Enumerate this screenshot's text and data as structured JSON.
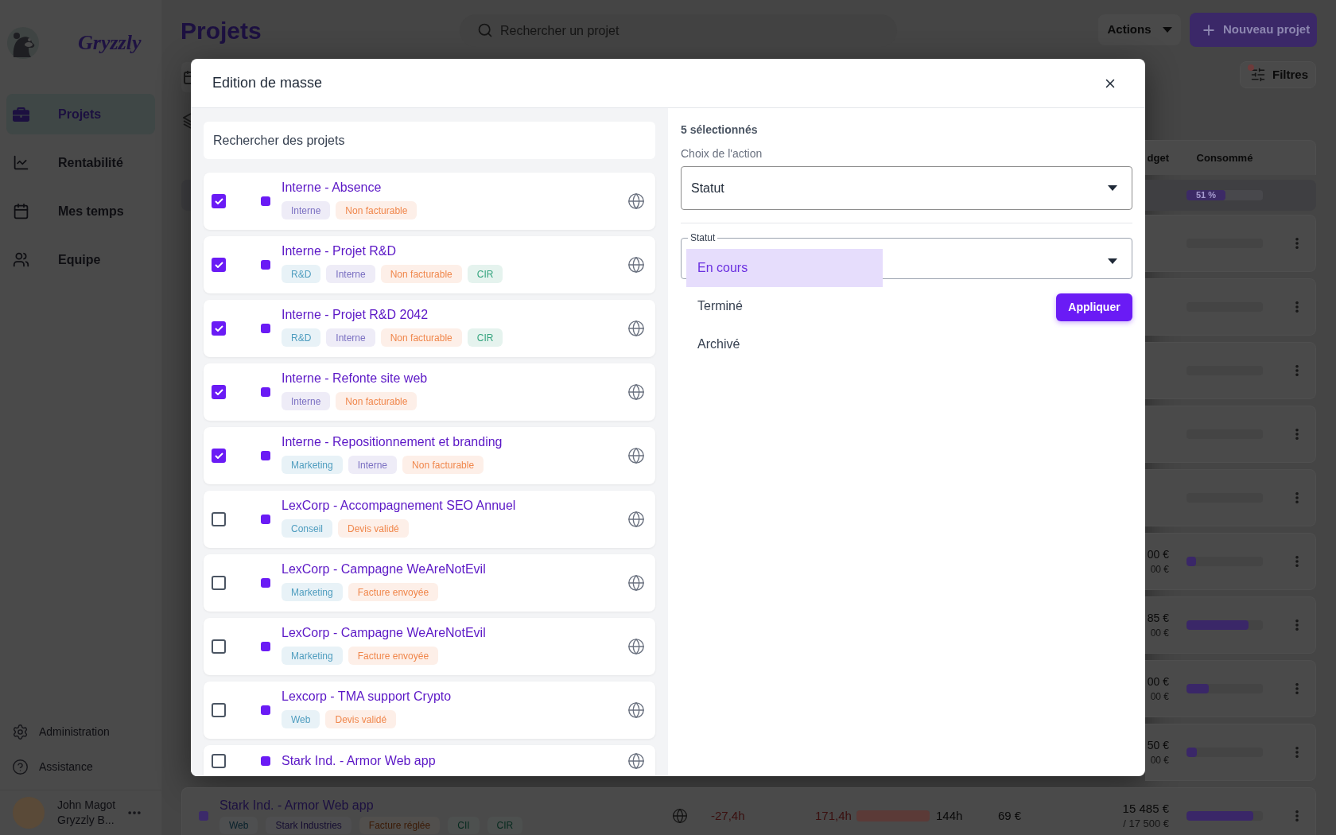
{
  "sidebar": {
    "logo_text": "Gryzzly",
    "nav": [
      {
        "label": "Projets",
        "selected": true
      },
      {
        "label": "Rentabilité",
        "selected": false
      },
      {
        "label": "Mes temps",
        "selected": false
      },
      {
        "label": "Equipe",
        "selected": false
      }
    ],
    "footer_links": [
      "Administration",
      "Assistance"
    ],
    "user": {
      "name": "John Magot",
      "company": "Gryzzly B..."
    }
  },
  "header": {
    "title": "Projets",
    "search": {
      "placeholder": "Rechercher un projet"
    },
    "actions_button": "Actions",
    "new_project_button": "Nouveau projet"
  },
  "toolbar": {
    "filters_button": "Filtres",
    "filters_badge": true
  },
  "table": {
    "columns": [
      "dget",
      "Consommé"
    ],
    "total_row": {
      "consumed": "51 %",
      "level": 0.51
    },
    "rows": [
      {},
      {},
      {},
      {},
      {},
      {
        "amount": "00 €",
        "budget": "00 €",
        "level": 0.13
      },
      {
        "amount": "85 €",
        "budget": "00 €",
        "level": 0.81
      },
      {
        "amount": "00 €",
        "budget": "00 €",
        "level": 0.29
      },
      {
        "amount": "50 €",
        "budget": "00 €",
        "level": 0.14
      }
    ],
    "last_row": {
      "name": "Stark Ind. - Armor Web app",
      "tags": [
        {
          "label": "Web",
          "color": "#07202a"
        },
        {
          "label": "Stark Industries",
          "color": "#140c30"
        },
        {
          "label": "Facture réglée",
          "color": "#3a1a05"
        },
        {
          "label": "CII",
          "color": "#062a1e"
        },
        {
          "label": "CIR",
          "color": "#062a1e"
        }
      ],
      "delta": "-27,4h",
      "spent": "171,4h",
      "spent_bar": {
        "level": 1
      },
      "planned": "144h",
      "rate": "69 €",
      "amount": "15 485 €",
      "budget": "/ 17 500 €",
      "level": 0.88
    }
  },
  "modal": {
    "title": "Edition de masse",
    "search": {
      "placeholder": "Rechercher des projets"
    },
    "projects": [
      {
        "name": "Interne - Absence",
        "checked": true,
        "tags": [
          {
            "label": "Interne",
            "color": "#7b70c2"
          },
          {
            "label": "Non facturable",
            "color": "#f0874c"
          }
        ]
      },
      {
        "name": "Interne - Projet R&D",
        "checked": true,
        "tags": [
          {
            "label": "R&D",
            "color": "#4f9dbf"
          },
          {
            "label": "Interne",
            "color": "#7b70c2"
          },
          {
            "label": "Non facturable",
            "color": "#f0874c"
          },
          {
            "label": "CIR",
            "color": "#36a57f"
          }
        ]
      },
      {
        "name": "Interne - Projet R&D 2042",
        "checked": true,
        "tags": [
          {
            "label": "R&D",
            "color": "#4f9dbf"
          },
          {
            "label": "Interne",
            "color": "#7b70c2"
          },
          {
            "label": "Non facturable",
            "color": "#f0874c"
          },
          {
            "label": "CIR",
            "color": "#36a57f"
          }
        ]
      },
      {
        "name": "Interne - Refonte site web",
        "checked": true,
        "tags": [
          {
            "label": "Interne",
            "color": "#7b70c2"
          },
          {
            "label": "Non facturable",
            "color": "#f0874c"
          }
        ]
      },
      {
        "name": "Interne - Repositionnement et branding",
        "checked": true,
        "tags": [
          {
            "label": "Marketing",
            "color": "#4f9dbf"
          },
          {
            "label": "Interne",
            "color": "#7b70c2"
          },
          {
            "label": "Non facturable",
            "color": "#f0874c"
          }
        ]
      },
      {
        "name": "LexCorp - Accompagnement SEO Annuel",
        "checked": false,
        "tags": [
          {
            "label": "Conseil",
            "color": "#4f9dbf"
          },
          {
            "label": "Devis validé",
            "color": "#f0874c"
          }
        ]
      },
      {
        "name": "LexCorp - Campagne WeAreNotEvil",
        "checked": false,
        "tags": [
          {
            "label": "Marketing",
            "color": "#4f9dbf"
          },
          {
            "label": "Facture envoyée",
            "color": "#f0874c"
          }
        ]
      },
      {
        "name": "LexCorp - Campagne WeAreNotEvil",
        "checked": false,
        "tags": [
          {
            "label": "Marketing",
            "color": "#4f9dbf"
          },
          {
            "label": "Facture envoyée",
            "color": "#f0874c"
          }
        ]
      },
      {
        "name": "Lexcorp - TMA support Crypto",
        "checked": false,
        "tags": [
          {
            "label": "Web",
            "color": "#4f9dbf"
          },
          {
            "label": "Devis validé",
            "color": "#f0874c"
          }
        ]
      },
      {
        "name": "Stark Ind. - Armor Web app",
        "checked": false
      }
    ],
    "selected_count": "5 sélectionnés",
    "action_label": "Choix de l'action",
    "action_select": {
      "value": "Statut"
    },
    "status_select": {
      "label": "Statut",
      "options": [
        {
          "label": "En cours",
          "selected": true
        },
        {
          "label": "Terminé",
          "selected": false
        },
        {
          "label": "Archivé",
          "selected": false
        }
      ]
    },
    "apply_button": "Appliquer"
  }
}
